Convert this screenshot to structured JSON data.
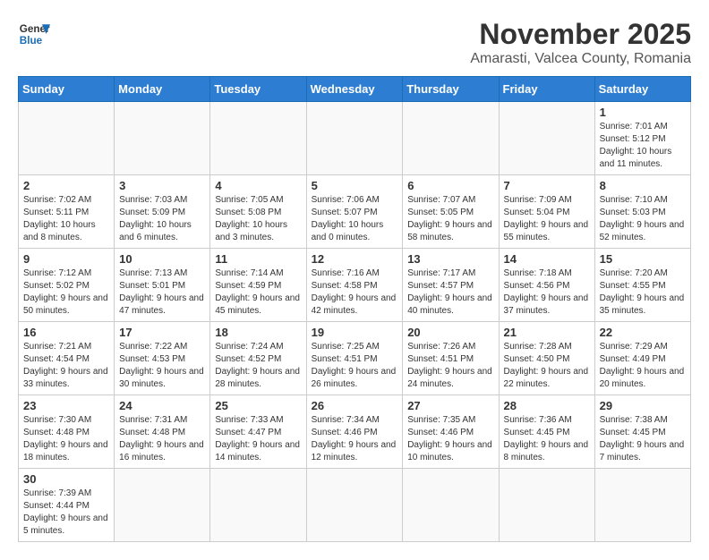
{
  "logo": {
    "line1": "General",
    "line2": "Blue"
  },
  "title": "November 2025",
  "location": "Amarasti, Valcea County, Romania",
  "days_of_week": [
    "Sunday",
    "Monday",
    "Tuesday",
    "Wednesday",
    "Thursday",
    "Friday",
    "Saturday"
  ],
  "weeks": [
    [
      {
        "day": "",
        "info": ""
      },
      {
        "day": "",
        "info": ""
      },
      {
        "day": "",
        "info": ""
      },
      {
        "day": "",
        "info": ""
      },
      {
        "day": "",
        "info": ""
      },
      {
        "day": "",
        "info": ""
      },
      {
        "day": "1",
        "info": "Sunrise: 7:01 AM\nSunset: 5:12 PM\nDaylight: 10 hours and 11 minutes."
      }
    ],
    [
      {
        "day": "2",
        "info": "Sunrise: 7:02 AM\nSunset: 5:11 PM\nDaylight: 10 hours and 8 minutes."
      },
      {
        "day": "3",
        "info": "Sunrise: 7:03 AM\nSunset: 5:09 PM\nDaylight: 10 hours and 6 minutes."
      },
      {
        "day": "4",
        "info": "Sunrise: 7:05 AM\nSunset: 5:08 PM\nDaylight: 10 hours and 3 minutes."
      },
      {
        "day": "5",
        "info": "Sunrise: 7:06 AM\nSunset: 5:07 PM\nDaylight: 10 hours and 0 minutes."
      },
      {
        "day": "6",
        "info": "Sunrise: 7:07 AM\nSunset: 5:05 PM\nDaylight: 9 hours and 58 minutes."
      },
      {
        "day": "7",
        "info": "Sunrise: 7:09 AM\nSunset: 5:04 PM\nDaylight: 9 hours and 55 minutes."
      },
      {
        "day": "8",
        "info": "Sunrise: 7:10 AM\nSunset: 5:03 PM\nDaylight: 9 hours and 52 minutes."
      }
    ],
    [
      {
        "day": "9",
        "info": "Sunrise: 7:12 AM\nSunset: 5:02 PM\nDaylight: 9 hours and 50 minutes."
      },
      {
        "day": "10",
        "info": "Sunrise: 7:13 AM\nSunset: 5:01 PM\nDaylight: 9 hours and 47 minutes."
      },
      {
        "day": "11",
        "info": "Sunrise: 7:14 AM\nSunset: 4:59 PM\nDaylight: 9 hours and 45 minutes."
      },
      {
        "day": "12",
        "info": "Sunrise: 7:16 AM\nSunset: 4:58 PM\nDaylight: 9 hours and 42 minutes."
      },
      {
        "day": "13",
        "info": "Sunrise: 7:17 AM\nSunset: 4:57 PM\nDaylight: 9 hours and 40 minutes."
      },
      {
        "day": "14",
        "info": "Sunrise: 7:18 AM\nSunset: 4:56 PM\nDaylight: 9 hours and 37 minutes."
      },
      {
        "day": "15",
        "info": "Sunrise: 7:20 AM\nSunset: 4:55 PM\nDaylight: 9 hours and 35 minutes."
      }
    ],
    [
      {
        "day": "16",
        "info": "Sunrise: 7:21 AM\nSunset: 4:54 PM\nDaylight: 9 hours and 33 minutes."
      },
      {
        "day": "17",
        "info": "Sunrise: 7:22 AM\nSunset: 4:53 PM\nDaylight: 9 hours and 30 minutes."
      },
      {
        "day": "18",
        "info": "Sunrise: 7:24 AM\nSunset: 4:52 PM\nDaylight: 9 hours and 28 minutes."
      },
      {
        "day": "19",
        "info": "Sunrise: 7:25 AM\nSunset: 4:51 PM\nDaylight: 9 hours and 26 minutes."
      },
      {
        "day": "20",
        "info": "Sunrise: 7:26 AM\nSunset: 4:51 PM\nDaylight: 9 hours and 24 minutes."
      },
      {
        "day": "21",
        "info": "Sunrise: 7:28 AM\nSunset: 4:50 PM\nDaylight: 9 hours and 22 minutes."
      },
      {
        "day": "22",
        "info": "Sunrise: 7:29 AM\nSunset: 4:49 PM\nDaylight: 9 hours and 20 minutes."
      }
    ],
    [
      {
        "day": "23",
        "info": "Sunrise: 7:30 AM\nSunset: 4:48 PM\nDaylight: 9 hours and 18 minutes."
      },
      {
        "day": "24",
        "info": "Sunrise: 7:31 AM\nSunset: 4:48 PM\nDaylight: 9 hours and 16 minutes."
      },
      {
        "day": "25",
        "info": "Sunrise: 7:33 AM\nSunset: 4:47 PM\nDaylight: 9 hours and 14 minutes."
      },
      {
        "day": "26",
        "info": "Sunrise: 7:34 AM\nSunset: 4:46 PM\nDaylight: 9 hours and 12 minutes."
      },
      {
        "day": "27",
        "info": "Sunrise: 7:35 AM\nSunset: 4:46 PM\nDaylight: 9 hours and 10 minutes."
      },
      {
        "day": "28",
        "info": "Sunrise: 7:36 AM\nSunset: 4:45 PM\nDaylight: 9 hours and 8 minutes."
      },
      {
        "day": "29",
        "info": "Sunrise: 7:38 AM\nSunset: 4:45 PM\nDaylight: 9 hours and 7 minutes."
      }
    ],
    [
      {
        "day": "30",
        "info": "Sunrise: 7:39 AM\nSunset: 4:44 PM\nDaylight: 9 hours and 5 minutes."
      },
      {
        "day": "",
        "info": ""
      },
      {
        "day": "",
        "info": ""
      },
      {
        "day": "",
        "info": ""
      },
      {
        "day": "",
        "info": ""
      },
      {
        "day": "",
        "info": ""
      },
      {
        "day": "",
        "info": ""
      }
    ]
  ]
}
